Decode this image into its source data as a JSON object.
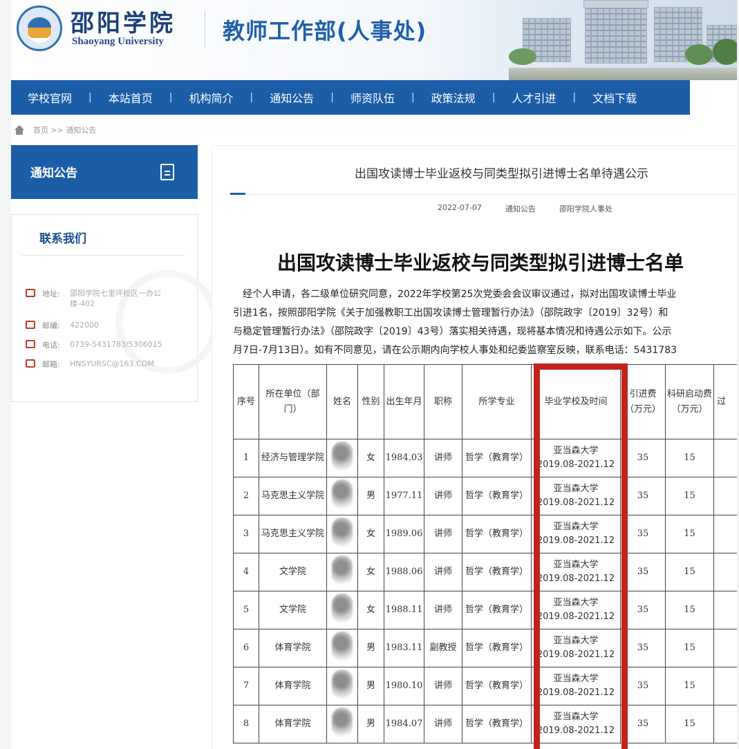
{
  "header": {
    "logo_cn": "邵阳学院",
    "logo_en": "Shaoyang University",
    "dept_title": "教师工作部(人事处)"
  },
  "nav": {
    "items": [
      "学校官网",
      "本站首页",
      "机构简介",
      "通知公告",
      "师资队伍",
      "政策法规",
      "人才引进",
      "文档下载"
    ],
    "separator": "|"
  },
  "breadcrumb": "首页 >> 通知公告",
  "sidebar": {
    "section_title": "通知公告",
    "contact_title": "联系我们",
    "contact": [
      {
        "key": "地址:",
        "value": "邵阳学院七里坪校区一办公楼-402"
      },
      {
        "key": "邮编:",
        "value": "422000"
      },
      {
        "key": "电话:",
        "value": "0739-5431783/5306015"
      },
      {
        "key": "邮箱:",
        "value": "HNSYURSC@163.COM"
      }
    ]
  },
  "article": {
    "title": "出国攻读博士毕业返校与同类型拟引进博士名单待遇公示",
    "date": "2022-07-07",
    "category": "通知公告",
    "source": "邵阳学院人事处",
    "big_title": "出国攻读博士毕业返校与同类型拟引进博士名单",
    "paragraph_lines": [
      "　经个人申请，各二级单位研究同意，2022年学校第25次党委会会议审议通过，拟对出国攻读博士毕业",
      "引进1名，按照邵阳学院《关于加强教职工出国攻读博士管理暂行办法》（邵院政字〔2019〕32号）和",
      "与稳定管理暂行办法》（邵院政字〔2019〕43号）落实相关待遇，现将基本情况和待遇公示如下。公示",
      "月7日-7月13日）。如有不同意见，请在公示期内向学校人事处和纪委监察室反映，联系电话：5431783"
    ]
  },
  "table": {
    "headers": [
      "序号",
      "所在单位（部门）",
      "姓名",
      "性别",
      "出生年月",
      "职称",
      "所学专业",
      "毕业学校及时间",
      "引进费（万元）",
      "科研启动费（万元）",
      "过"
    ],
    "rows": [
      {
        "no": "1",
        "unit": "经济与管理学院",
        "gender": "女",
        "birth": "1984.03",
        "title": "讲师",
        "major": "哲学（教育学）",
        "school": "亚当森大学",
        "period": "2019.08-2021.12",
        "fee": "35",
        "research": "15"
      },
      {
        "no": "2",
        "unit": "马克思主义学院",
        "gender": "男",
        "birth": "1977.11",
        "title": "讲师",
        "major": "哲学（教育学）",
        "school": "亚当森大学",
        "period": "2019.08-2021.12",
        "fee": "35",
        "research": "15"
      },
      {
        "no": "3",
        "unit": "马克思主义学院",
        "gender": "女",
        "birth": "1989.06",
        "title": "讲师",
        "major": "哲学（教育学）",
        "school": "亚当森大学",
        "period": "2019.08-2021.12",
        "fee": "35",
        "research": "15"
      },
      {
        "no": "4",
        "unit": "文学院",
        "gender": "女",
        "birth": "1988.06",
        "title": "讲师",
        "major": "哲学（教育学）",
        "school": "亚当森大学",
        "period": "2019.08-2021.12",
        "fee": "35",
        "research": "15"
      },
      {
        "no": "5",
        "unit": "文学院",
        "gender": "女",
        "birth": "1988.11",
        "title": "讲师",
        "major": "哲学（教育学）",
        "school": "亚当森大学",
        "period": "2019.08-2021.12",
        "fee": "35",
        "research": "15"
      },
      {
        "no": "6",
        "unit": "体育学院",
        "gender": "男",
        "birth": "1983.11",
        "title": "副教授",
        "major": "哲学（教育学）",
        "school": "亚当森大学",
        "period": "2019.08-2021.12",
        "fee": "35",
        "research": "15"
      },
      {
        "no": "7",
        "unit": "体育学院",
        "gender": "男",
        "birth": "1980.10",
        "title": "讲师",
        "major": "哲学（教育学）",
        "school": "亚当森大学",
        "period": "2019.08-2021.12",
        "fee": "35",
        "research": "15"
      },
      {
        "no": "8",
        "unit": "体育学院",
        "gender": "男",
        "birth": "1984.07",
        "title": "讲师",
        "major": "哲学（教育学）",
        "school": "亚当森大学",
        "period": "2019.08-2021.12",
        "fee": "35",
        "research": "15"
      }
    ]
  },
  "colors": {
    "brand_blue": "#1c5da8",
    "highlight_red": "#c0231c"
  }
}
